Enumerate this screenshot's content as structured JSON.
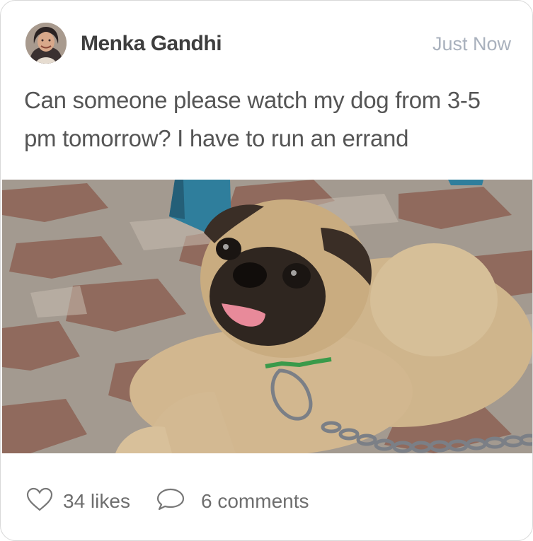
{
  "post": {
    "author_name": "Menka Gandhi",
    "timestamp": "Just Now",
    "text": "Can someone please watch my dog from 3-5 pm tomorrow? I have to run an errand"
  },
  "actions": {
    "likes_label": "34 likes",
    "comments_label": "6 comments",
    "like_icon": "heart-outline-icon",
    "comment_icon": "speech-bubble-icon"
  },
  "colors": {
    "author": "#3e3e3e",
    "timestamp": "#a9b1bd",
    "body_text": "#555555",
    "action_text": "#6e6e6e",
    "card_border": "#d8d8d8"
  }
}
